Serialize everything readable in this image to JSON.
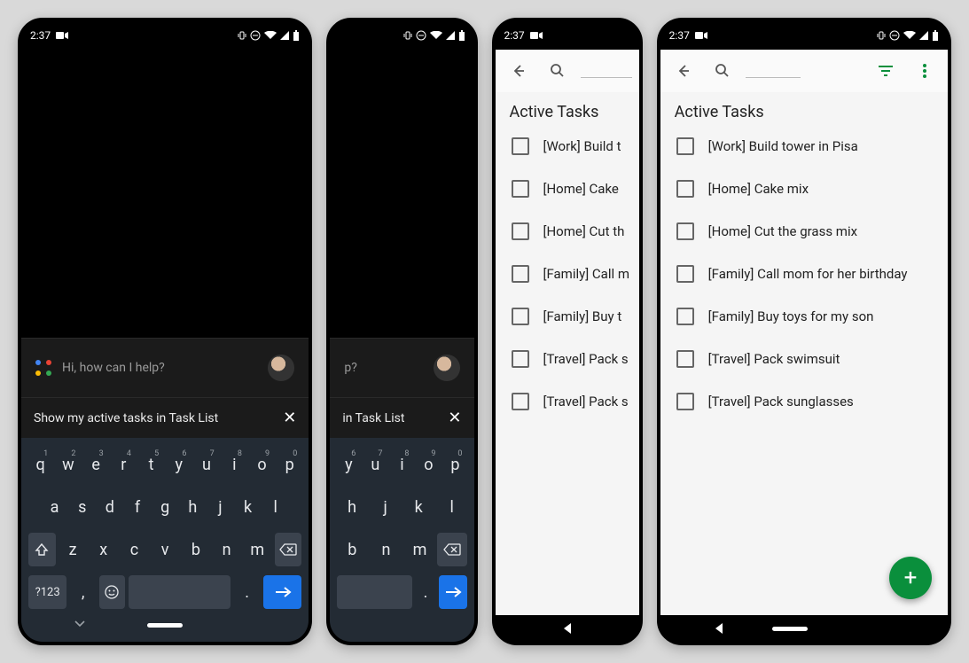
{
  "status": {
    "time": "2:37"
  },
  "assistant": {
    "greeting": "Hi, how can I help?",
    "query_full": "Show my active tasks in Task List",
    "query_partial": "in Task List"
  },
  "keyboard": {
    "row1": [
      {
        "k": "q",
        "n": "1"
      },
      {
        "k": "w",
        "n": "2"
      },
      {
        "k": "e",
        "n": "3"
      },
      {
        "k": "r",
        "n": "4"
      },
      {
        "k": "t",
        "n": "5"
      },
      {
        "k": "y",
        "n": "6"
      },
      {
        "k": "u",
        "n": "7"
      },
      {
        "k": "i",
        "n": "8"
      },
      {
        "k": "o",
        "n": "9"
      },
      {
        "k": "p",
        "n": "0"
      }
    ],
    "row2": [
      "a",
      "s",
      "d",
      "f",
      "g",
      "h",
      "j",
      "k",
      "l"
    ],
    "row3": [
      "z",
      "x",
      "c",
      "v",
      "b",
      "n",
      "m"
    ],
    "symkey": "?123",
    "comma": ",",
    "period": "."
  },
  "app": {
    "section_title": "Active Tasks",
    "tasks": [
      "[Work] Build tower in Pisa",
      "[Home] Cake mix",
      "[Home] Cut the grass mix",
      "[Family] Call mom for her birthday",
      "[Family] Buy toys for my son",
      "[Travel] Pack swimsuit",
      "[Travel] Pack sunglasses"
    ],
    "tasks_truncated": [
      "[Work] Build t",
      "[Home] Cake",
      "[Home] Cut th",
      "[Family] Call m",
      "[Family] Buy t",
      "[Travel] Pack s",
      "[Travel] Pack s"
    ]
  }
}
